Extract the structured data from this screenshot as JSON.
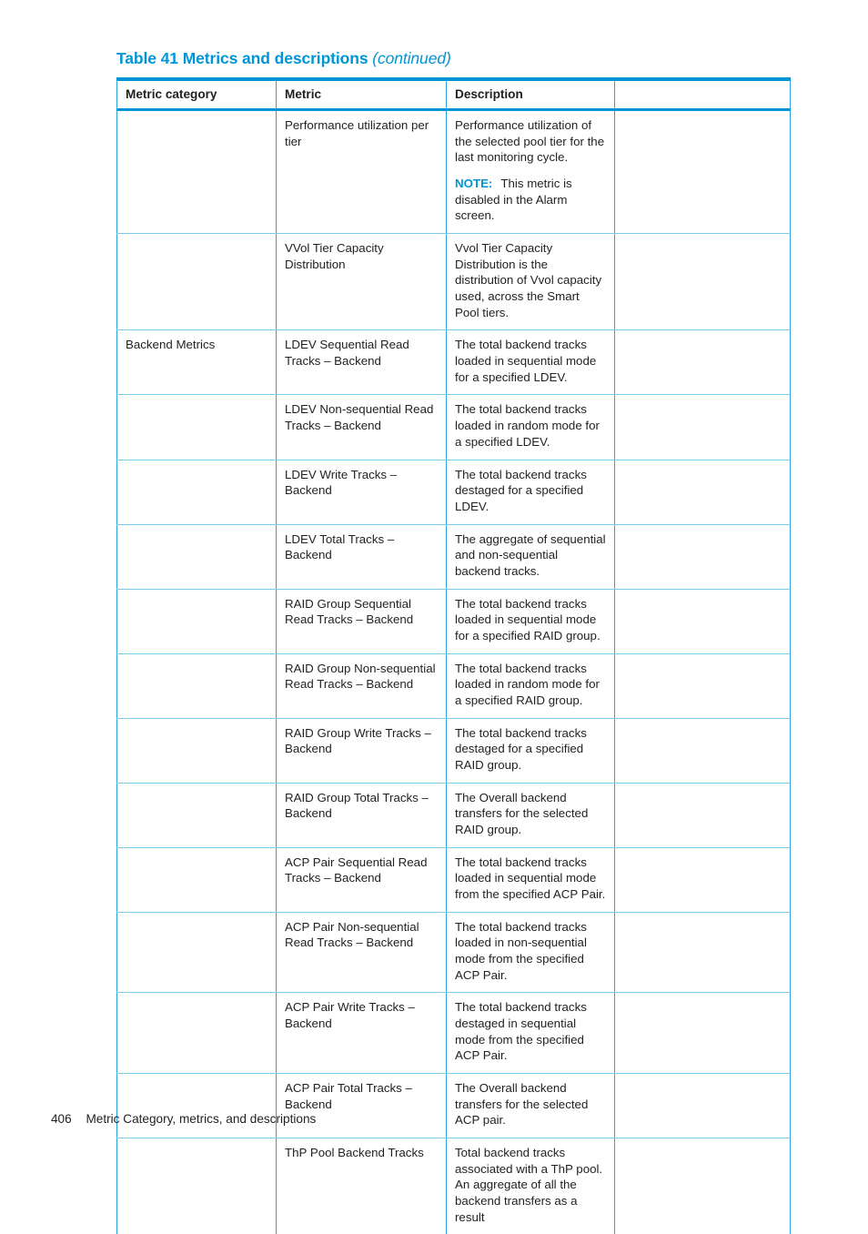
{
  "caption": {
    "main": "Table 41 Metrics and descriptions",
    "continued": "(continued)"
  },
  "colors": {
    "brand_blue": "#0096d6",
    "rule_light_blue": "#7fc9ea",
    "cell_border_blue": "#29a3dc",
    "text": "#231f20"
  },
  "table": {
    "headers": {
      "col1": "Metric category",
      "col2": "Metric",
      "col3": "Description",
      "col4": ""
    },
    "rows": [
      {
        "category": "",
        "metric": "Performance utilization per tier",
        "description": "Performance utilization of the selected pool tier for the last monitoring cycle.",
        "note_label": "NOTE:",
        "note_text": "This metric is disabled in the Alarm screen.",
        "extra": ""
      },
      {
        "category": "",
        "metric": "VVol Tier Capacity Distribution",
        "description": "Vvol Tier Capacity Distribution is the distribution of Vvol capacity used, across the Smart Pool tiers.",
        "extra": ""
      },
      {
        "category": "Backend Metrics",
        "metric": "LDEV Sequential Read Tracks – Backend",
        "description": "The total backend tracks loaded in sequential mode for a specified LDEV.",
        "extra": ""
      },
      {
        "category": "",
        "metric": "LDEV Non-sequential Read Tracks – Backend",
        "description": "The total backend tracks loaded in random mode for a specified LDEV.",
        "extra": ""
      },
      {
        "category": "",
        "metric": "LDEV Write Tracks – Backend",
        "description": "The total backend tracks destaged for a specified LDEV.",
        "extra": ""
      },
      {
        "category": "",
        "metric": "LDEV Total Tracks – Backend",
        "description": "The aggregate of sequential and non-sequential backend tracks.",
        "extra": ""
      },
      {
        "category": "",
        "metric": "RAID Group Sequential Read Tracks – Backend",
        "description": "The total backend tracks loaded in sequential mode for a specified RAID group.",
        "extra": ""
      },
      {
        "category": "",
        "metric": "RAID Group Non-sequential Read Tracks – Backend",
        "description": "The total backend tracks loaded in random mode for a specified RAID group.",
        "extra": ""
      },
      {
        "category": "",
        "metric": "RAID Group Write Tracks – Backend",
        "description": "The total backend tracks destaged for a specified RAID group.",
        "extra": ""
      },
      {
        "category": "",
        "metric": "RAID Group Total Tracks – Backend",
        "description": "The Overall backend transfers for the selected RAID group.",
        "extra": ""
      },
      {
        "category": "",
        "metric": "ACP Pair Sequential Read Tracks – Backend",
        "description": "The total backend tracks loaded in sequential mode from the specified ACP Pair.",
        "extra": ""
      },
      {
        "category": "",
        "metric": "ACP Pair Non-sequential Read Tracks – Backend",
        "description": "The total backend tracks loaded in non-sequential mode from the specified ACP Pair.",
        "extra": ""
      },
      {
        "category": "",
        "metric": "ACP Pair Write Tracks – Backend",
        "description": "The total backend tracks destaged in sequential mode from the specified ACP Pair.",
        "extra": ""
      },
      {
        "category": "",
        "metric": "ACP Pair Total Tracks – Backend",
        "description": "The Overall backend transfers for the selected ACP pair.",
        "extra": ""
      },
      {
        "category": "",
        "metric": "ThP Pool Backend Tracks",
        "description": "Total backend tracks associated with a ThP pool. An aggregate of all the backend transfers as a result",
        "extra": ""
      }
    ]
  },
  "footer": {
    "page_number": "406",
    "section_title": "Metric Category, metrics, and descriptions"
  }
}
